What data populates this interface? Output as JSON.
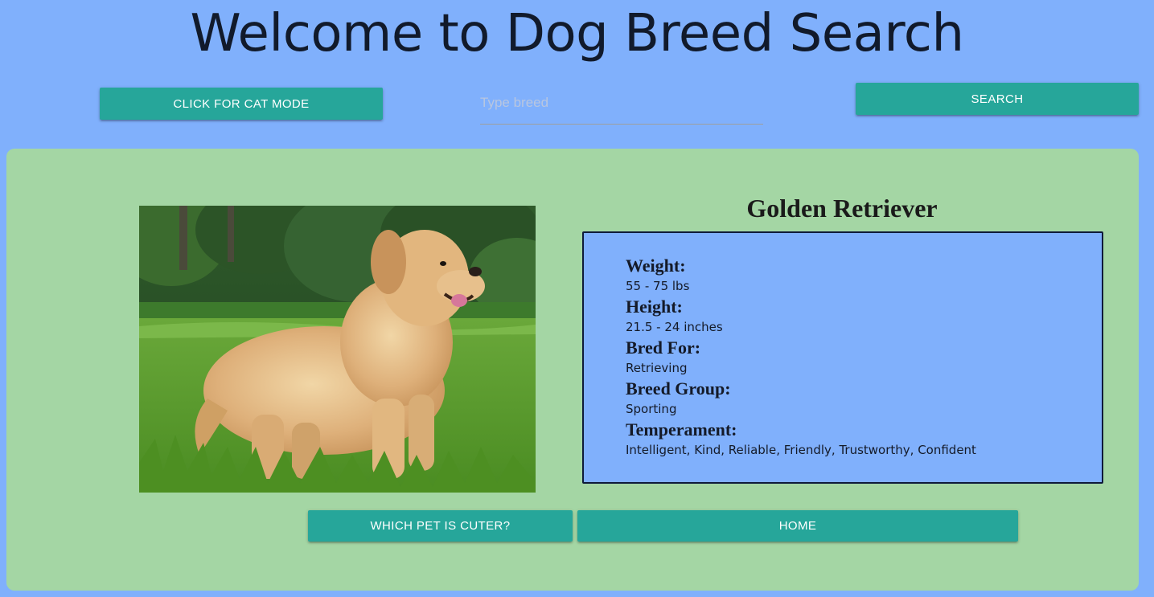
{
  "header": {
    "title": "Welcome to Dog Breed Search"
  },
  "toolbar": {
    "cat_mode_label": "CLICK FOR CAT MODE",
    "search_placeholder": "Type breed",
    "search_value": "",
    "search_label": "SEARCH"
  },
  "breed": {
    "name": "Golden Retriever",
    "photo_alt": "Golden Retriever",
    "details": [
      {
        "label": "Weight:",
        "value": "55 - 75 lbs"
      },
      {
        "label": "Height:",
        "value": "21.5 - 24 inches"
      },
      {
        "label": "Bred For:",
        "value": "Retrieving"
      },
      {
        "label": "Breed Group:",
        "value": "Sporting"
      },
      {
        "label": "Temperament:",
        "value": "Intelligent, Kind, Reliable, Friendly, Trustworthy, Confident"
      }
    ]
  },
  "actions": {
    "cuter_label": "WHICH PET IS CUTER?",
    "home_label": "HOME"
  },
  "colors": {
    "page_background": "#80b0fc",
    "card_background": "#a4d6a4",
    "button_accent": "#26a69a",
    "info_box_border": "#0e1a3a"
  }
}
